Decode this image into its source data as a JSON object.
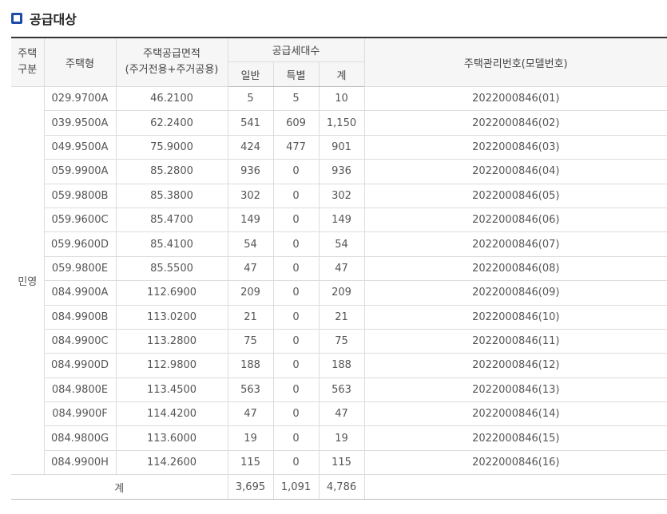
{
  "section": {
    "title": "공급대상"
  },
  "table": {
    "headers": {
      "division_line1": "주택",
      "division_line2": "구분",
      "housing_type": "주택형",
      "area_line1": "주택공급면적",
      "area_line2": "(주거전용+주거공용)",
      "units_group": "공급세대수",
      "general": "일반",
      "special": "특별",
      "total": "계",
      "mgmt_no": "주택관리번호(모델번호)"
    },
    "division": "민영",
    "rows": [
      {
        "type": "029.9700A",
        "area": "46.2100",
        "general": "5",
        "special": "5",
        "total": "10",
        "mgmt": "2022000846(01)"
      },
      {
        "type": "039.9500A",
        "area": "62.2400",
        "general": "541",
        "special": "609",
        "total": "1,150",
        "mgmt": "2022000846(02)"
      },
      {
        "type": "049.9500A",
        "area": "75.9000",
        "general": "424",
        "special": "477",
        "total": "901",
        "mgmt": "2022000846(03)"
      },
      {
        "type": "059.9900A",
        "area": "85.2800",
        "general": "936",
        "special": "0",
        "total": "936",
        "mgmt": "2022000846(04)"
      },
      {
        "type": "059.9800B",
        "area": "85.3800",
        "general": "302",
        "special": "0",
        "total": "302",
        "mgmt": "2022000846(05)"
      },
      {
        "type": "059.9600C",
        "area": "85.4700",
        "general": "149",
        "special": "0",
        "total": "149",
        "mgmt": "2022000846(06)"
      },
      {
        "type": "059.9600D",
        "area": "85.4100",
        "general": "54",
        "special": "0",
        "total": "54",
        "mgmt": "2022000846(07)"
      },
      {
        "type": "059.9800E",
        "area": "85.5500",
        "general": "47",
        "special": "0",
        "total": "47",
        "mgmt": "2022000846(08)"
      },
      {
        "type": "084.9900A",
        "area": "112.6900",
        "general": "209",
        "special": "0",
        "total": "209",
        "mgmt": "2022000846(09)"
      },
      {
        "type": "084.9900B",
        "area": "113.0200",
        "general": "21",
        "special": "0",
        "total": "21",
        "mgmt": "2022000846(10)"
      },
      {
        "type": "084.9900C",
        "area": "113.2800",
        "general": "75",
        "special": "0",
        "total": "75",
        "mgmt": "2022000846(11)"
      },
      {
        "type": "084.9900D",
        "area": "112.9800",
        "general": "188",
        "special": "0",
        "total": "188",
        "mgmt": "2022000846(12)"
      },
      {
        "type": "084.9800E",
        "area": "113.4500",
        "general": "563",
        "special": "0",
        "total": "563",
        "mgmt": "2022000846(13)"
      },
      {
        "type": "084.9900F",
        "area": "114.4200",
        "general": "47",
        "special": "0",
        "total": "47",
        "mgmt": "2022000846(14)"
      },
      {
        "type": "084.9800G",
        "area": "113.6000",
        "general": "19",
        "special": "0",
        "total": "19",
        "mgmt": "2022000846(15)"
      },
      {
        "type": "084.9900H",
        "area": "114.2600",
        "general": "115",
        "special": "0",
        "total": "115",
        "mgmt": "2022000846(16)"
      }
    ],
    "totals": {
      "label": "계",
      "general": "3,695",
      "special": "1,091",
      "total": "4,786",
      "mgmt": ""
    }
  }
}
